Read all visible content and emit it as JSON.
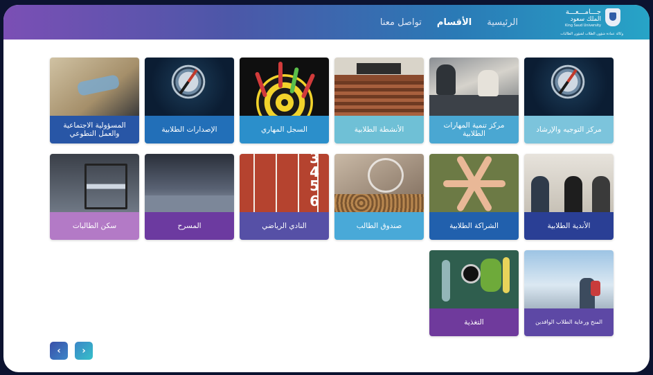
{
  "logo": {
    "name_line1": "جـــامـــعـــة",
    "name_line2": "الملك سعود",
    "name_line3": "King Saud University",
    "subtitle": "وكالة عمادة شؤون الطلاب لشؤون الطالبات"
  },
  "nav": {
    "home": "الرئيسية",
    "sections": "الأقسام",
    "contact": "تواصل معنا"
  },
  "cards": [
    {
      "label": "مركز التوجيه والإرشاد",
      "color": "#7cc4dc"
    },
    {
      "label": "مركز تنمية المهارات الطلابية",
      "color": "#4aa7d2"
    },
    {
      "label": "الأنشطة الطلابية",
      "color": "#6fc0d6"
    },
    {
      "label": "السجل المهاري",
      "color": "#2b8fcb"
    },
    {
      "label": "الإصدارات الطلابية",
      "color": "#226fb8"
    },
    {
      "label": "المسؤولية الاجتماعية والعمل التطوعي",
      "color": "#2856a6"
    },
    {
      "label": "الأندية الطلابية",
      "color": "#2a3f95"
    },
    {
      "label": "الشراكة الطلابية",
      "color": "#2160ad"
    },
    {
      "label": "صندوق الطالب",
      "color": "#49a9d8"
    },
    {
      "label": "النادي الرياضي",
      "color": "#5650a6"
    },
    {
      "label": "المسرح",
      "color": "#6c3aa0"
    },
    {
      "label": "سكن الطالبات",
      "color": "#b37ac6"
    },
    {
      "label": "المنح ورعاية الطلاب الوافدين",
      "color": "#5d48a5"
    },
    {
      "label": "التغذية",
      "color": "#6f3a9c"
    }
  ],
  "track_numbers": [
    "3",
    "4",
    "5",
    "6"
  ],
  "pager": {
    "prev": "‹",
    "next": "›"
  }
}
